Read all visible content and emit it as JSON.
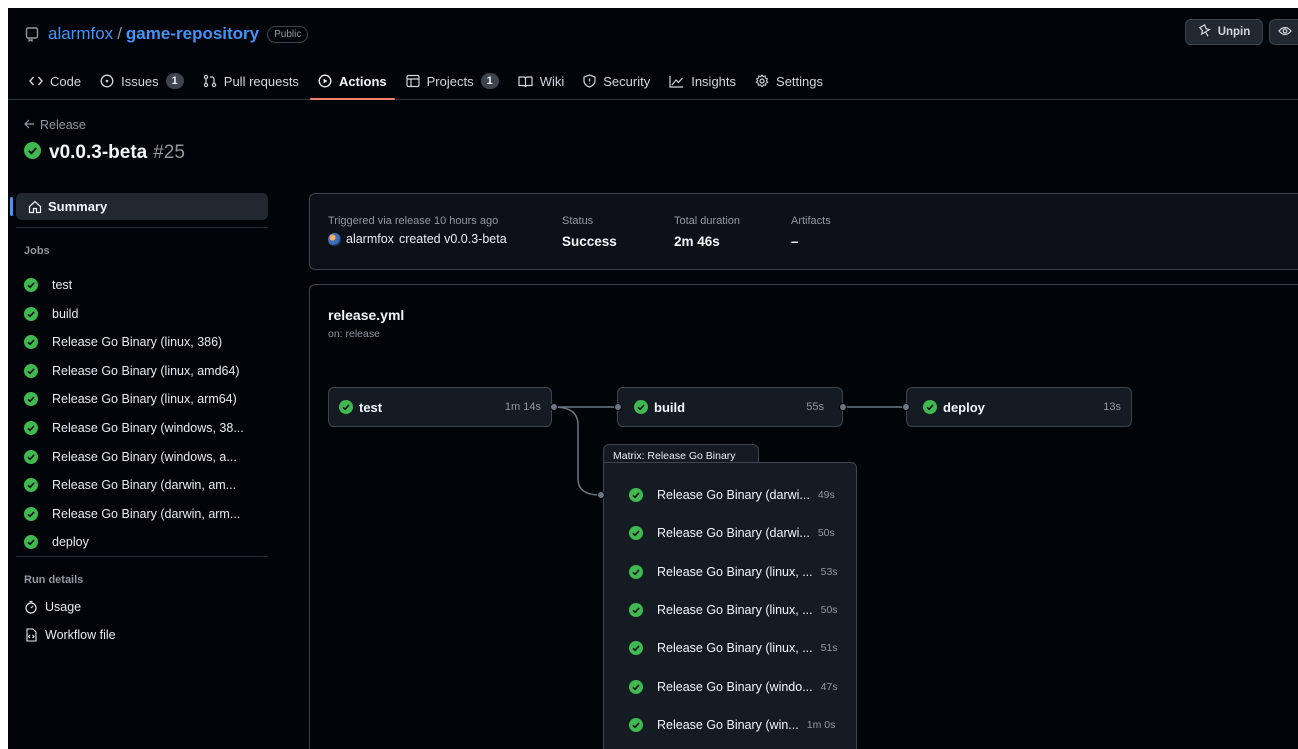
{
  "repo": {
    "owner": "alarmfox",
    "separator": "/",
    "name": "game-repository",
    "visibility": "Public",
    "unpin_label": "Unpin"
  },
  "tabs": [
    {
      "label": "Code",
      "icon": "code-icon"
    },
    {
      "label": "Issues",
      "icon": "issue-icon",
      "count": "1"
    },
    {
      "label": "Pull requests",
      "icon": "pull-request-icon"
    },
    {
      "label": "Actions",
      "icon": "play-icon",
      "active": true
    },
    {
      "label": "Projects",
      "icon": "table-icon",
      "count": "1"
    },
    {
      "label": "Wiki",
      "icon": "book-icon"
    },
    {
      "label": "Security",
      "icon": "shield-icon"
    },
    {
      "label": "Insights",
      "icon": "graph-icon"
    },
    {
      "label": "Settings",
      "icon": "gear-icon"
    }
  ],
  "run": {
    "back_label": "Release",
    "title": "v0.0.3-beta",
    "number": "#25"
  },
  "sidebar": {
    "summary_label": "Summary",
    "jobs_heading": "Jobs",
    "jobs": [
      "test",
      "build",
      "Release Go Binary (linux, 386)",
      "Release Go Binary (linux, amd64)",
      "Release Go Binary (linux, arm64)",
      "Release Go Binary (windows, 38...",
      "Release Go Binary (windows, a...",
      "Release Go Binary (darwin, am...",
      "Release Go Binary (darwin, arm...",
      "deploy"
    ],
    "run_details_heading": "Run details",
    "usage_label": "Usage",
    "workflow_file_label": "Workflow file"
  },
  "summary": {
    "trigger_label": "Triggered via release 10 hours ago",
    "trigger_user": "alarmfox",
    "trigger_text": "created v0.0.3-beta",
    "status_label": "Status",
    "status_value": "Success",
    "duration_label": "Total duration",
    "duration_value": "2m 46s",
    "artifacts_label": "Artifacts",
    "artifacts_value": "–"
  },
  "graph": {
    "workflow_name": "release.yml",
    "trigger": "on: release",
    "jobs": {
      "test": {
        "label": "test",
        "duration": "1m 14s"
      },
      "build": {
        "label": "build",
        "duration": "55s"
      },
      "deploy": {
        "label": "deploy",
        "duration": "13s"
      }
    },
    "matrix_title": "Matrix: Release Go Binary",
    "matrix_items": [
      {
        "label": "Release Go Binary (darwi...",
        "duration": "49s"
      },
      {
        "label": "Release Go Binary (darwi...",
        "duration": "50s"
      },
      {
        "label": "Release Go Binary (linux, ...",
        "duration": "53s"
      },
      {
        "label": "Release Go Binary (linux, ...",
        "duration": "50s"
      },
      {
        "label": "Release Go Binary (linux, ...",
        "duration": "51s"
      },
      {
        "label": "Release Go Binary (windo...",
        "duration": "47s"
      },
      {
        "label": "Release Go Binary (win...",
        "duration": "1m 0s"
      }
    ]
  },
  "colors": {
    "success": "#3fb950",
    "accent": "#4493f8",
    "active_tab_underline": "#f78166",
    "background": "#010409"
  }
}
